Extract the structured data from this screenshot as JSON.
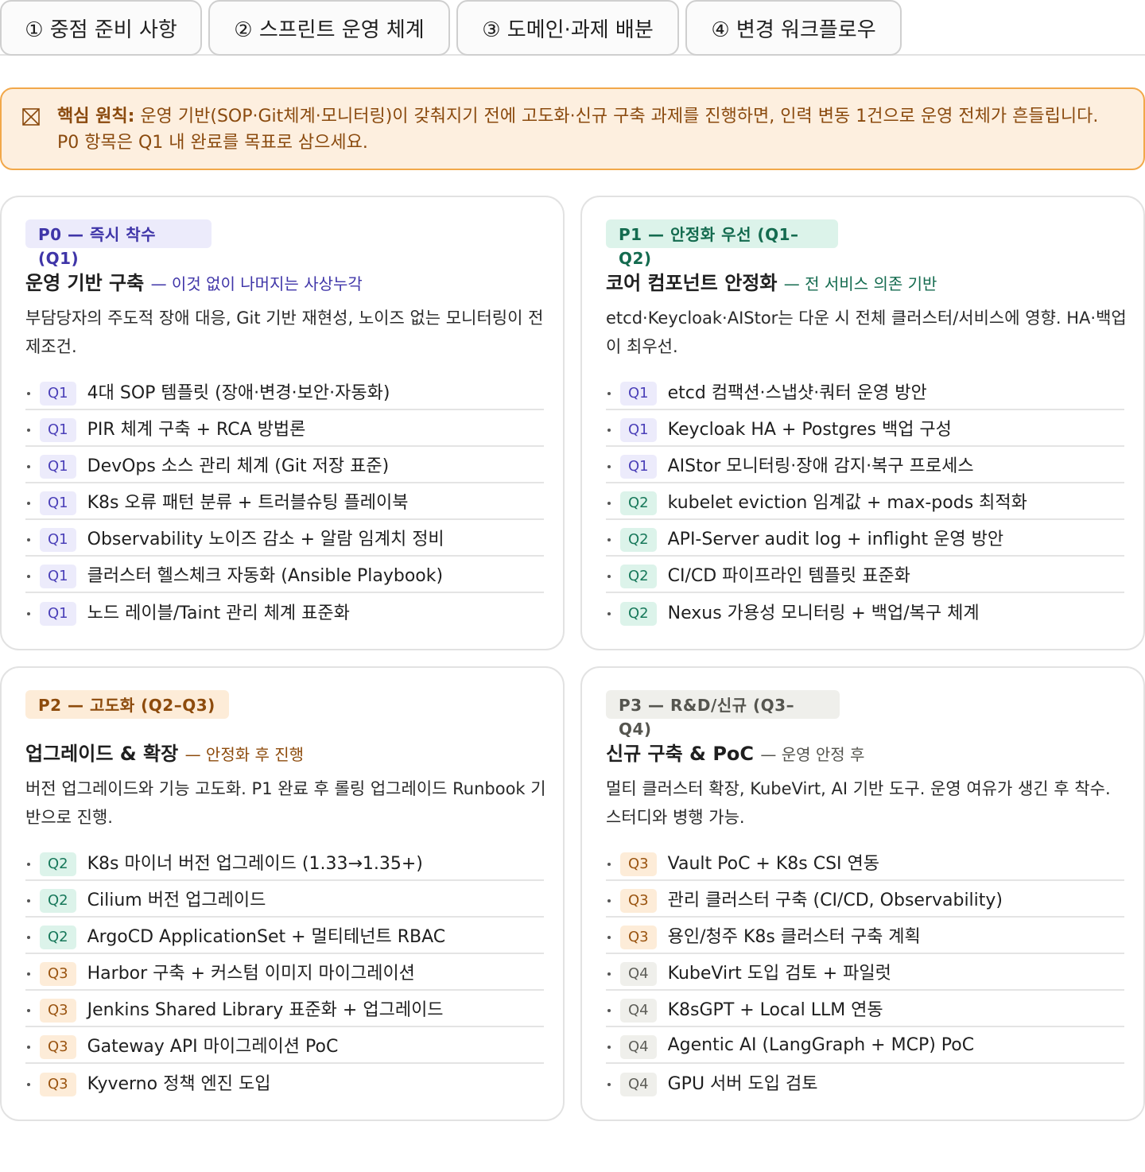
{
  "tabs": [
    {
      "label": "① 중점 준비 사항"
    },
    {
      "label": "② 스프린트 운영 체계"
    },
    {
      "label": "③ 도메인·과제 배분"
    },
    {
      "label": "④ 변경 워크플로우"
    }
  ],
  "callout": {
    "icon": "box-x-icon",
    "label": "핵심 원칙:",
    "text": " 운영 기반(SOP·Git체계·모니터링)이 갖춰지기 전에 고도화·신규 구축 과제를 진행하면, 인력 변동 1건으로 운영 전체가 흔들립니다. P0 항목은 Q1 내 완료를 목표로 삼으세요.",
    "colors": {
      "background": "#fdefdf",
      "border": "#f2a84a",
      "text": "#8a4a0e"
    }
  },
  "cards": [
    {
      "badge": "P0 — 즉시 착수 (Q1)",
      "title": "운영 기반 구축",
      "subtitle": "— 이것 없이 나머지는 사상누각",
      "description": "부담당자의 주도적 장애 대응, Git 기반 재현성, 노이즈 없는 모니터링이 전제조건.",
      "items": [
        {
          "q": "Q1",
          "text": "4대 SOP 템플릿 (장애·변경·보안·자동화)"
        },
        {
          "q": "Q1",
          "text": "PIR 체계 구축 + RCA 방법론"
        },
        {
          "q": "Q1",
          "text": "DevOps 소스 관리 체계 (Git 저장 표준)"
        },
        {
          "q": "Q1",
          "text": "K8s 오류 패턴 분류 + 트러블슈팅 플레이북"
        },
        {
          "q": "Q1",
          "text": "Observability 노이즈 감소 + 알람 임계치 정비"
        },
        {
          "q": "Q1",
          "text": "클러스터 헬스체크 자동화 (Ansible Playbook)"
        },
        {
          "q": "Q1",
          "text": "노드 레이블/Taint 관리 체계 표준화"
        }
      ]
    },
    {
      "badge": "P1 — 안정화 우선 (Q1–Q2)",
      "title": "코어 컴포넌트 안정화",
      "subtitle": "— 전 서비스 의존 기반",
      "description": "etcd·Keycloak·AIStor는 다운 시 전체 클러스터/서비스에 영향. HA·백업이 최우선.",
      "items": [
        {
          "q": "Q1",
          "text": "etcd 컴팩션·스냅샷·쿼터 운영 방안"
        },
        {
          "q": "Q1",
          "text": "Keycloak HA + Postgres 백업 구성"
        },
        {
          "q": "Q1",
          "text": "AIStor 모니터링·장애 감지·복구 프로세스"
        },
        {
          "q": "Q2",
          "text": "kubelet eviction 임계값 + max-pods 최적화"
        },
        {
          "q": "Q2",
          "text": "API-Server audit log + inflight 운영 방안"
        },
        {
          "q": "Q2",
          "text": "CI/CD 파이프라인 템플릿 표준화"
        },
        {
          "q": "Q2",
          "text": "Nexus 가용성 모니터링 + 백업/복구 체계"
        }
      ]
    },
    {
      "badge": "P2 — 고도화 (Q2–Q3)",
      "title": "업그레이드 & 확장",
      "subtitle": "— 안정화 후 진행",
      "description": "버전 업그레이드와 기능 고도화. P1 완료 후 롤링 업그레이드 Runbook 기반으로 진행.",
      "items": [
        {
          "q": "Q2",
          "text": "K8s 마이너 버전 업그레이드 (1.33→1.35+)"
        },
        {
          "q": "Q2",
          "text": "Cilium 버전 업그레이드"
        },
        {
          "q": "Q2",
          "text": "ArgoCD ApplicationSet + 멀티테넌트 RBAC"
        },
        {
          "q": "Q3",
          "text": "Harbor 구축 + 커스텀 이미지 마이그레이션"
        },
        {
          "q": "Q3",
          "text": "Jenkins Shared Library 표준화 + 업그레이드"
        },
        {
          "q": "Q3",
          "text": "Gateway API 마이그레이션 PoC"
        },
        {
          "q": "Q3",
          "text": "Kyverno 정책 엔진 도입"
        }
      ]
    },
    {
      "badge": "P3 — R&D/신규 (Q3–Q4)",
      "title": "신규 구축 & PoC",
      "subtitle": "— 운영 안정 후",
      "description": "멀티 클러스터 확장, KubeVirt, AI 기반 도구. 운영 여유가 생긴 후 착수. 스터디와 병행 가능.",
      "items": [
        {
          "q": "Q3",
          "text": "Vault PoC + K8s CSI 연동"
        },
        {
          "q": "Q3",
          "text": "관리 클러스터 구축 (CI/CD, Observability)"
        },
        {
          "q": "Q3",
          "text": "용인/청주 K8s 클러스터 구축 계획"
        },
        {
          "q": "Q4",
          "text": "KubeVirt 도입 검토 + 파일럿"
        },
        {
          "q": "Q4",
          "text": "K8sGPT + Local LLM 연동"
        },
        {
          "q": "Q4",
          "text": "Agentic AI (LangGraph + MCP) PoC"
        },
        {
          "q": "Q4",
          "text": "GPU 서버 도입 검토"
        }
      ]
    }
  ],
  "colors": {
    "p0_badge_bg": "#ecebfb",
    "p0_accent": "#3f35a8",
    "p1_badge_bg": "#dcf3ea",
    "p1_accent": "#146b4f",
    "p2_badge_bg": "#fdecd8",
    "p2_accent": "#8d4b0c",
    "p3_badge_bg": "#efefeb",
    "p3_accent": "#55554f"
  }
}
